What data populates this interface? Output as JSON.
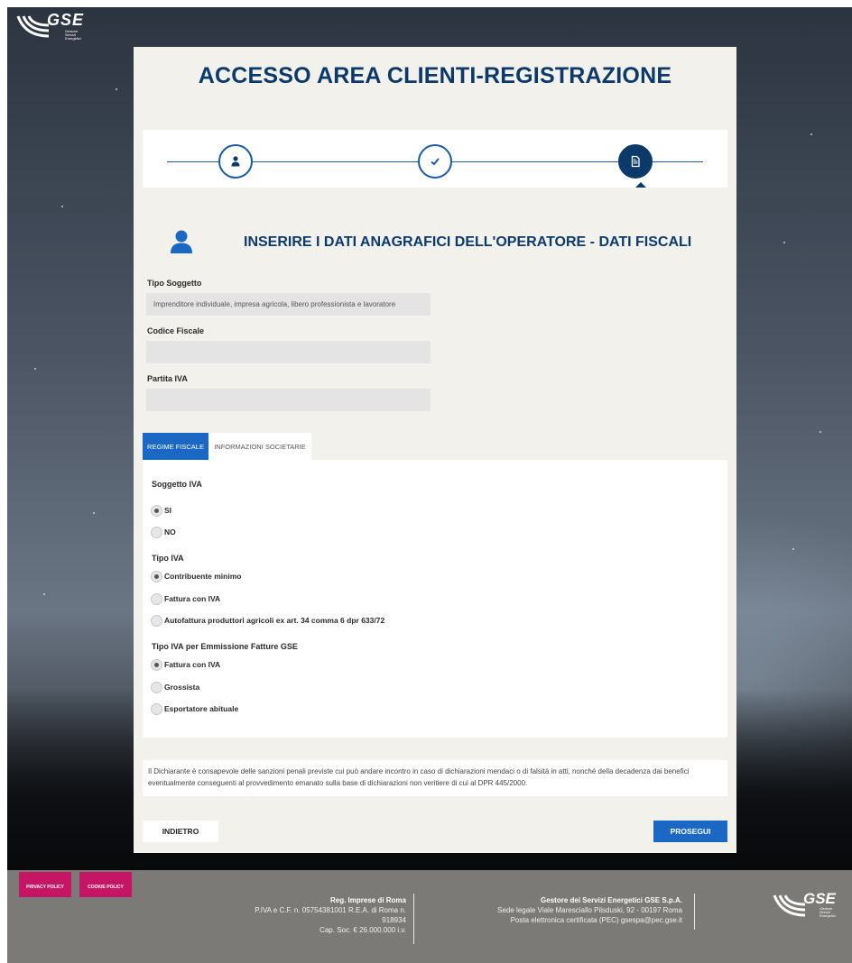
{
  "brand": {
    "logo_text": "GSE",
    "logo_sub": "Gestore Servizi Energetici"
  },
  "page": {
    "title": "ACCESSO AREA CLIENTI-REGISTRAZIONE"
  },
  "stepper": {
    "steps": [
      {
        "icon": "user-icon",
        "state": "done"
      },
      {
        "icon": "check-icon",
        "state": "done"
      },
      {
        "icon": "document-icon",
        "state": "active"
      }
    ]
  },
  "section": {
    "icon": "user-icon",
    "title": "INSERIRE I DATI ANAGRAFICI DELL'OPERATORE - DATI FISCALI"
  },
  "fields": {
    "tipo_soggetto": {
      "label": "Tipo Soggetto",
      "value": "Imprenditore individuale, impresa agricola, libero professionista e lavoratore"
    },
    "codice_fiscale": {
      "label": "Codice Fiscale",
      "value": ""
    },
    "partita_iva": {
      "label": "Partita IVA",
      "value": ""
    }
  },
  "tabs": [
    {
      "label": "REGIME FISCALE",
      "active": true
    },
    {
      "label": "INFORMAZIONI SOCIETARIE",
      "active": false
    }
  ],
  "regime": {
    "soggetto_iva": {
      "label": "Soggetto IVA",
      "options": [
        "SI",
        "NO"
      ],
      "selected": "SI"
    },
    "tipo_iva": {
      "label": "Tipo IVA",
      "options": [
        "Contribuente minimo",
        "Fattura con IVA",
        "Autofattura produttori agricoli ex art. 34 comma 6 dpr 633/72"
      ],
      "selected": "Contribuente minimo"
    },
    "tipo_iva_gse": {
      "label": "Tipo IVA per Emmissione Fatture GSE",
      "options": [
        "Fattura con IVA",
        "Grossista",
        "Esportatore abituale"
      ],
      "selected": "Fattura con IVA"
    }
  },
  "disclaimer": "Il Dichiarante è consapevole delle sanzioni penali previste cui può andare incontro in caso di dichiarazioni mendaci o di falsità in atti, nonché della decadenza dai benefici eventualmente conseguenti al provvedimento emanato sulla base di dichiarazioni non veritiere di cui al DPR 445/2000.",
  "buttons": {
    "back": "INDIETRO",
    "next": "PROSEGUI"
  },
  "footer": {
    "privacy": "PRIVACY POLICY",
    "cookie": "COOKIE POLICY",
    "reg_title": "Reg. Imprese di Roma",
    "reg_line1": "P.IVA e C.F. n. 05754381001 R.E.A. di Roma n.",
    "reg_line2": "918934",
    "reg_line3": "Cap. Soc. € 26.000.000 i.v.",
    "gse_title": "Gestore dei Servizi Energetici GSE S.p.A.",
    "gse_line1": "Sede legale Viale Maresciallo Pilsduski, 92 - 00197 Roma",
    "gse_line2": "Posta elettronica certificata (PEC) gsespa@pec.gse.it"
  },
  "colors": {
    "primary": "#0b3a6a",
    "accent": "#1b68c4",
    "policy": "#c71565",
    "footer": "#7c7a77"
  }
}
